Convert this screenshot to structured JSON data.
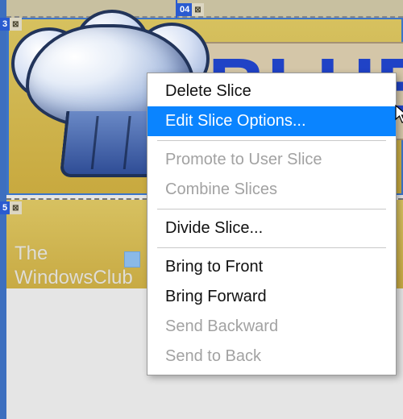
{
  "slices": {
    "s3": "3",
    "s04": "04",
    "s5": "5"
  },
  "canvas_text": {
    "blue": "BLUE"
  },
  "watermark": {
    "line1": "The",
    "line2": "WindowsClub"
  },
  "context_menu": {
    "items": [
      {
        "key": "delete-slice",
        "label": "Delete Slice",
        "enabled": true,
        "highlight": false
      },
      {
        "key": "edit-slice-options",
        "label": "Edit Slice Options...",
        "enabled": true,
        "highlight": true
      },
      {
        "sep": true
      },
      {
        "key": "promote-user-slice",
        "label": "Promote to User Slice",
        "enabled": false,
        "highlight": false
      },
      {
        "key": "combine-slices",
        "label": "Combine Slices",
        "enabled": false,
        "highlight": false
      },
      {
        "sep": true
      },
      {
        "key": "divide-slice",
        "label": "Divide Slice...",
        "enabled": true,
        "highlight": false
      },
      {
        "sep": true
      },
      {
        "key": "bring-to-front",
        "label": "Bring to Front",
        "enabled": true,
        "highlight": false
      },
      {
        "key": "bring-forward",
        "label": "Bring Forward",
        "enabled": true,
        "highlight": false
      },
      {
        "key": "send-backward",
        "label": "Send Backward",
        "enabled": false,
        "highlight": false
      },
      {
        "key": "send-to-back",
        "label": "Send to Back",
        "enabled": false,
        "highlight": false
      }
    ]
  },
  "icons": {
    "slice_type": "⊠"
  },
  "colors": {
    "menu_highlight": "#0a84ff",
    "slice_badge": "#2a5bd0",
    "canvas_gold": "#c8aa43"
  }
}
